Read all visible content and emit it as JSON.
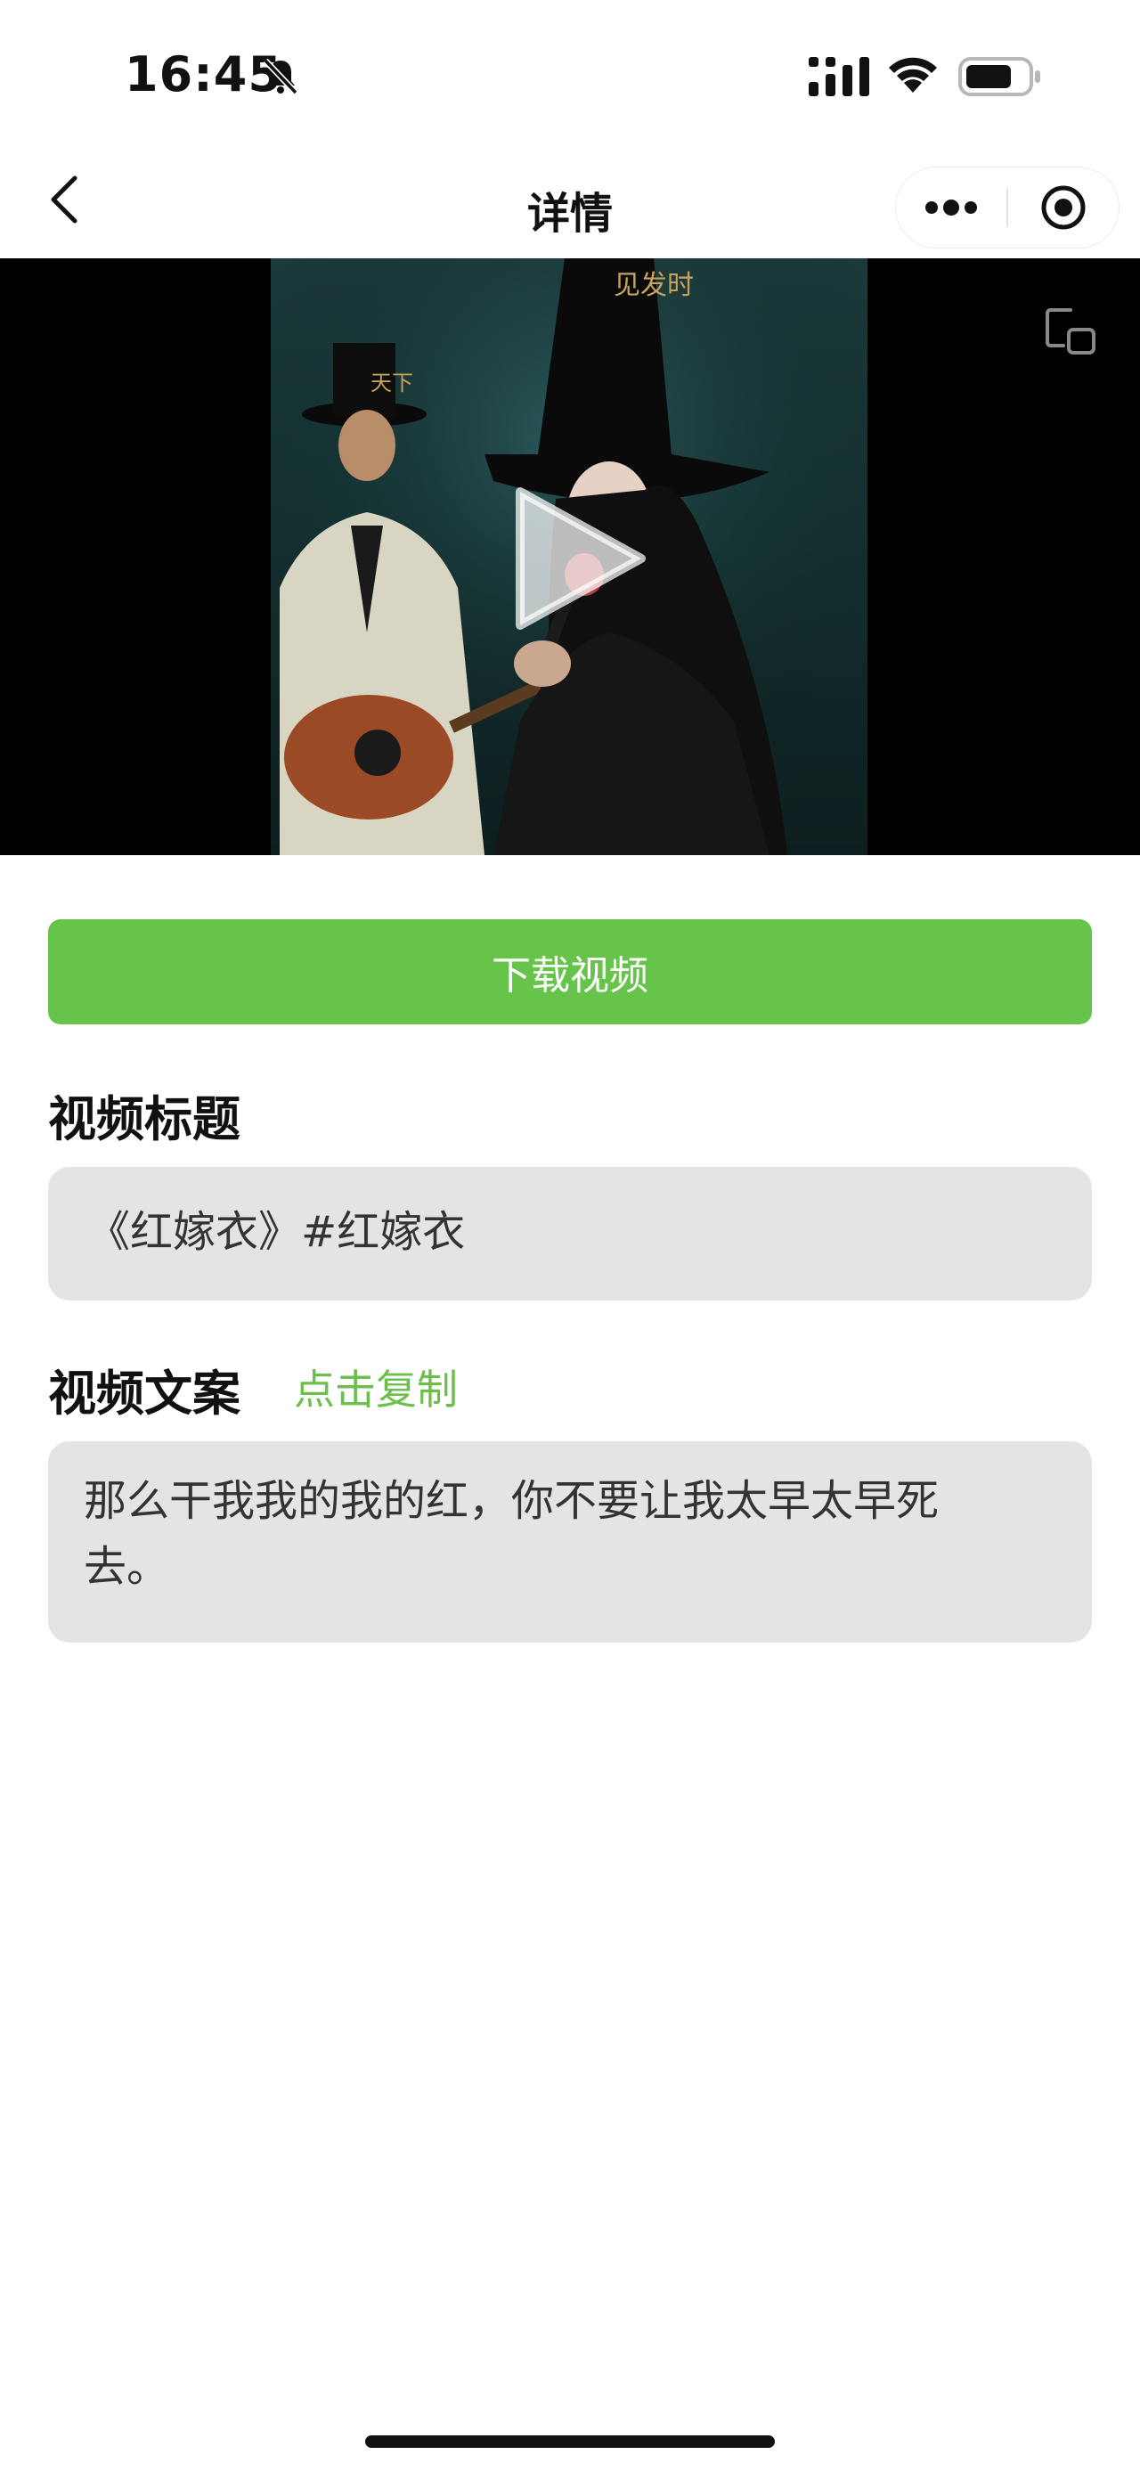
{
  "status_bar": {
    "time": "16:45"
  },
  "nav": {
    "title": "详情"
  },
  "actions": {
    "download_label": "下载视频"
  },
  "title_section": {
    "heading": "视频标题",
    "value": "《红嫁衣》#红嫁衣"
  },
  "caption_section": {
    "heading": "视频文案",
    "copy_label": "点击复制",
    "value": "那么干我我的我的红，你不要让我太早太早死去。"
  },
  "video": {
    "overlay_text_left": "天下",
    "overlay_text_right": "见发时"
  },
  "colors": {
    "accent_green": "#67c44a",
    "copy_link_green": "#6dbf4b",
    "box_gray": "#e4e4e4"
  },
  "icons": [
    "bell-muted-icon",
    "signal-icon",
    "wifi-icon",
    "battery-icon",
    "back-icon",
    "more-icon",
    "close-target-icon",
    "play-icon",
    "pip-icon"
  ]
}
